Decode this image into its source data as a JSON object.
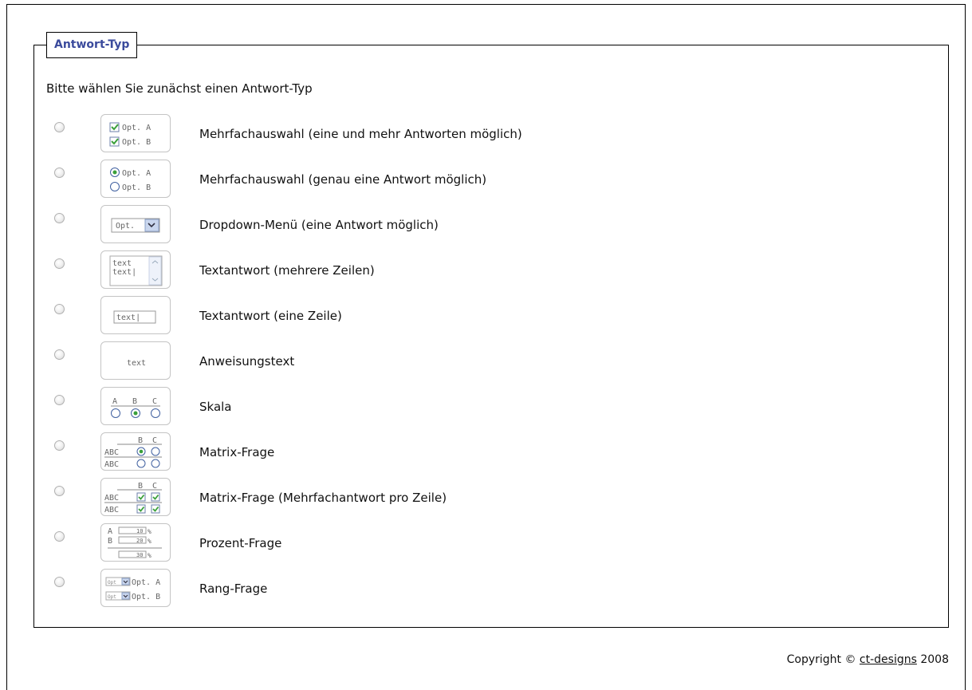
{
  "fieldset": {
    "legend": "Antwort-Typ",
    "intro": "Bitte wählen Sie zunächst einen Antwort-Typ"
  },
  "options": [
    {
      "label": "Mehrfachauswahl (eine und mehr Antworten möglich)",
      "icon": "checkbox-options-icon"
    },
    {
      "label": "Mehrfachauswahl (genau eine Antwort möglich)",
      "icon": "radio-options-icon"
    },
    {
      "label": "Dropdown-Menü (eine Antwort möglich)",
      "icon": "dropdown-icon"
    },
    {
      "label": "Textantwort (mehrere Zeilen)",
      "icon": "textarea-icon"
    },
    {
      "label": "Textantwort (eine Zeile)",
      "icon": "textfield-icon"
    },
    {
      "label": "Anweisungstext",
      "icon": "instruction-text-icon"
    },
    {
      "label": "Skala",
      "icon": "scale-icon"
    },
    {
      "label": "Matrix-Frage",
      "icon": "matrix-radio-icon"
    },
    {
      "label": "Matrix-Frage (Mehrfachantwort pro Zeile)",
      "icon": "matrix-checkbox-icon"
    },
    {
      "label": "Prozent-Frage",
      "icon": "percent-icon"
    },
    {
      "label": "Rang-Frage",
      "icon": "rank-icon"
    }
  ],
  "icon_text": {
    "opt_a": "Opt. A",
    "opt_b": "Opt. B",
    "opt": "Opt.",
    "text": "text",
    "text_cursor": "text|",
    "a": "A",
    "b": "B",
    "c": "C",
    "abc": "ABC",
    "p10": "10",
    "p20": "20",
    "p30": "30",
    "pct": "%",
    "opt_small": "Opt"
  },
  "footer": {
    "copyright_prefix": "Copyright ©",
    "link": "ct-designs",
    "year": "2008"
  },
  "colors": {
    "legend_text": "#3a4a9c",
    "icon_check": "#3aa03a",
    "icon_border": "#6b7fa8"
  }
}
